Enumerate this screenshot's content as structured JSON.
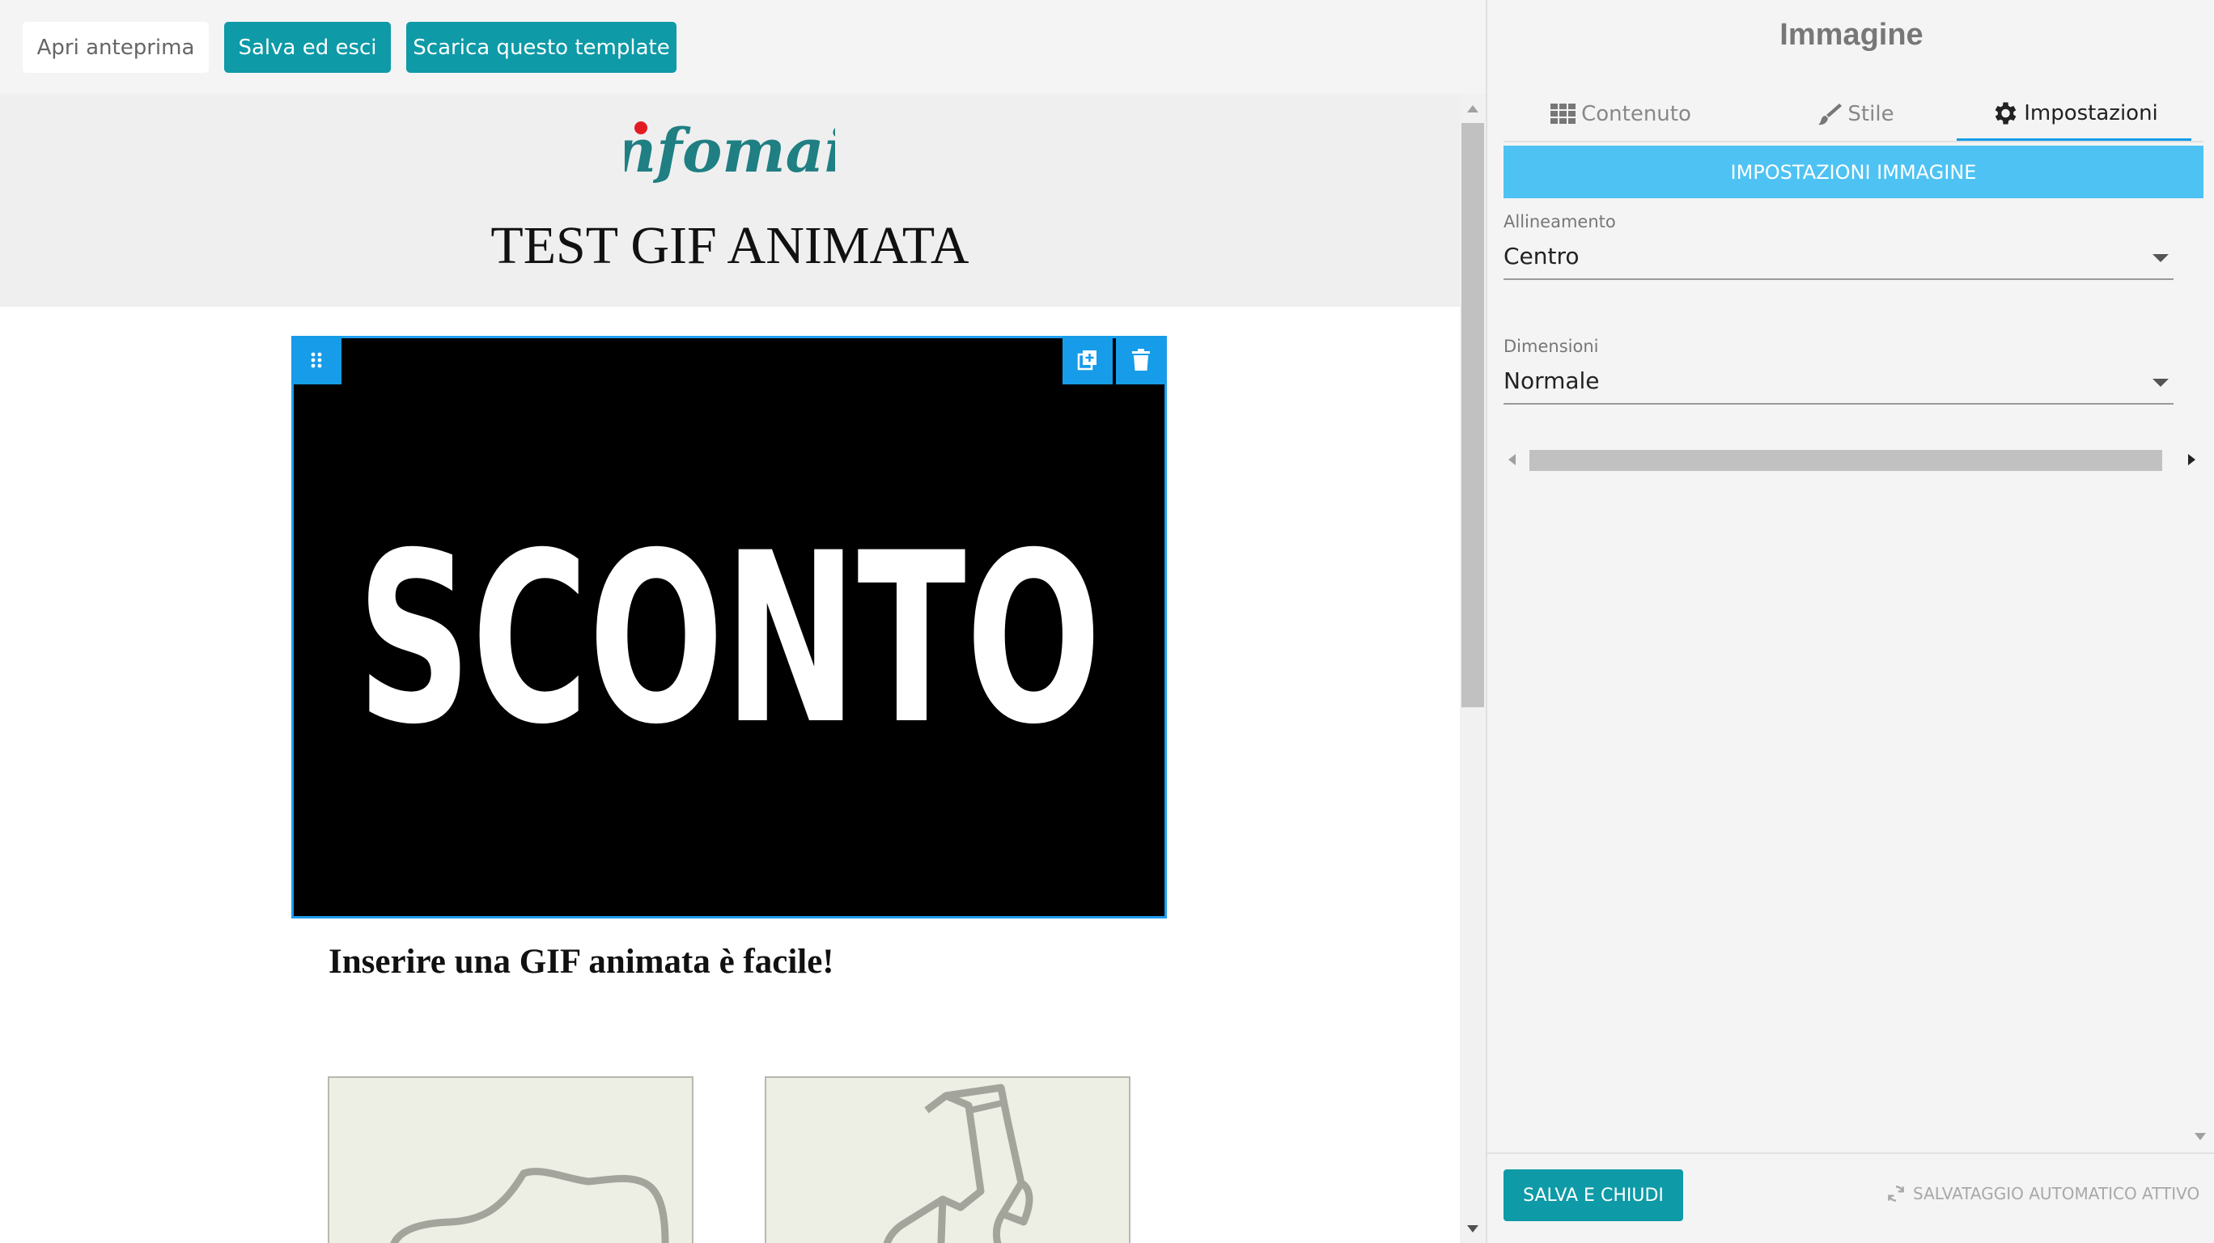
{
  "toolbar": {
    "preview_label": "Apri anteprima",
    "save_exit_label": "Salva ed esci",
    "download_label": "Scarica questo template"
  },
  "email": {
    "logo_text": "infomail",
    "title": "TEST GIF ANIMATA",
    "image_text": "SCONTO",
    "subheading": "Inserire una GIF animata è facile!"
  },
  "panel": {
    "title": "Immagine",
    "tabs": [
      {
        "label": "Contenuto",
        "icon": "grid-icon"
      },
      {
        "label": "Stile",
        "icon": "brush-icon"
      },
      {
        "label": "Impostazioni",
        "icon": "gear-icon",
        "active": true
      }
    ],
    "section_title": "IMPOSTAZIONI IMMAGINE",
    "fields": {
      "alignment": {
        "label": "Allineamento",
        "value": "Centro"
      },
      "size": {
        "label": "Dimensioni",
        "value": "Normale"
      }
    },
    "save_close_label": "SALVA E CHIUDI",
    "autosave_label": "SALVATAGGIO AUTOMATICO ATTIVO"
  },
  "colors": {
    "accent_teal": "#0e9aa7",
    "selection_blue": "#169ce8",
    "section_bar": "#4ec2f3",
    "logo_teal": "#1f7f83",
    "logo_dot": "#e21b23"
  }
}
